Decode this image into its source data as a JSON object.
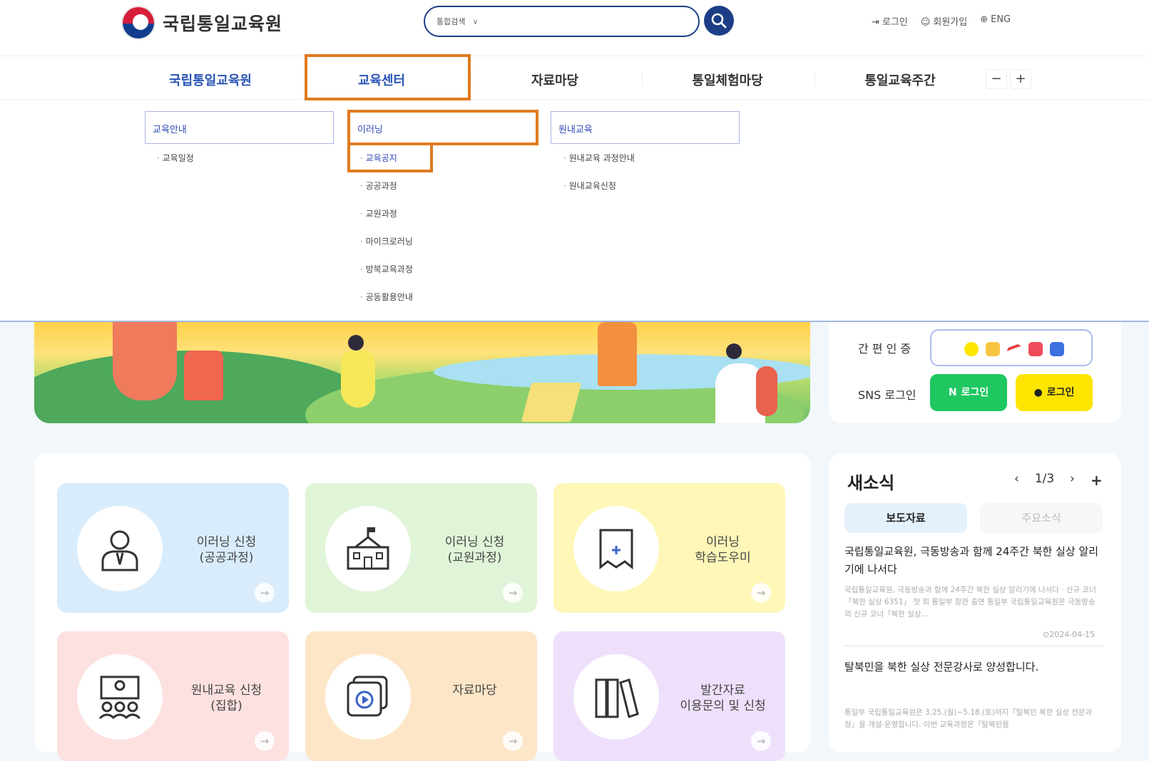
{
  "header": {
    "logo_text": "국립통일교육원",
    "search_scope": "통합검색",
    "util": [
      {
        "icon": "login-icon",
        "label": "로그인"
      },
      {
        "icon": "user-icon",
        "label": "회원가입"
      },
      {
        "icon": "globe-icon",
        "label": "ENG"
      }
    ]
  },
  "gnb": {
    "items": [
      "국립통일교육원",
      "교육센터",
      "자료마당",
      "통일체험마당",
      "통일교육주간"
    ],
    "zoom_out": "−",
    "zoom_in": "+"
  },
  "mega": {
    "col1": {
      "head": "교육안내",
      "items": [
        "교육일정"
      ]
    },
    "col2": {
      "head": "이러닝",
      "items": [
        "교육공지",
        "공공과정",
        "교원과정",
        "마이크로러닝",
        "방북교육과정",
        "공동활용안내"
      ]
    },
    "col3": {
      "head": "원내교육",
      "items": [
        "원내교육 과정안내",
        "원내교육신청"
      ]
    }
  },
  "login": {
    "easy_label": "간 편 인 증",
    "sns_label": "SNS 로그인",
    "naver": "로그인",
    "naver_mark": "N",
    "kakao": "로그인"
  },
  "quick": [
    {
      "label": "이러닝 신청\n(공공과정)",
      "icon": "person-icon",
      "color": "#d8ecfb"
    },
    {
      "label": "이러닝 신청\n(교원과정)",
      "icon": "school-icon",
      "color": "#e0f5d8"
    },
    {
      "label": "이러닝\n학습도우미",
      "icon": "bookmark-icon",
      "color": "#fff7b8"
    },
    {
      "label": "원내교육 신청\n(집합)",
      "icon": "lecture-icon",
      "color": "#fde0e0"
    },
    {
      "label": "자료마당",
      "icon": "video-icon",
      "color": "#fde6c8"
    },
    {
      "label": "발간자료\n이용문의 및 신청",
      "icon": "books-icon",
      "color": "#eee0fb"
    }
  ],
  "news": {
    "title": "새소식",
    "page": "1/3",
    "tab_active": "보도자료",
    "tab_inactive": "주요소식",
    "items": [
      {
        "head": "국립통일교육원, 극동방송과 함께 24주간 북한 실상 알리기에 나서다",
        "body": "국립통일교육원, 극동방송과 함께 24주간 북한 실상 알리기에 나서다 · 신규 코너「북한 실상 6351」 첫 회 통일부 장관 출연 통일부 국립통일교육원은 극동방송의 신규 코너「북한 실상…",
        "date": "2024-04-15"
      },
      {
        "head": "탈북민을 북한 실상 전문강사로 양성합니다.",
        "body": "통일부 국립통일교육원은 3.25.(월)~5.18.(토)까지「탈북민 북한 실상 전문과정」을 개설·운영합니다. 이번 교육과정은「탈북민을"
      }
    ]
  }
}
